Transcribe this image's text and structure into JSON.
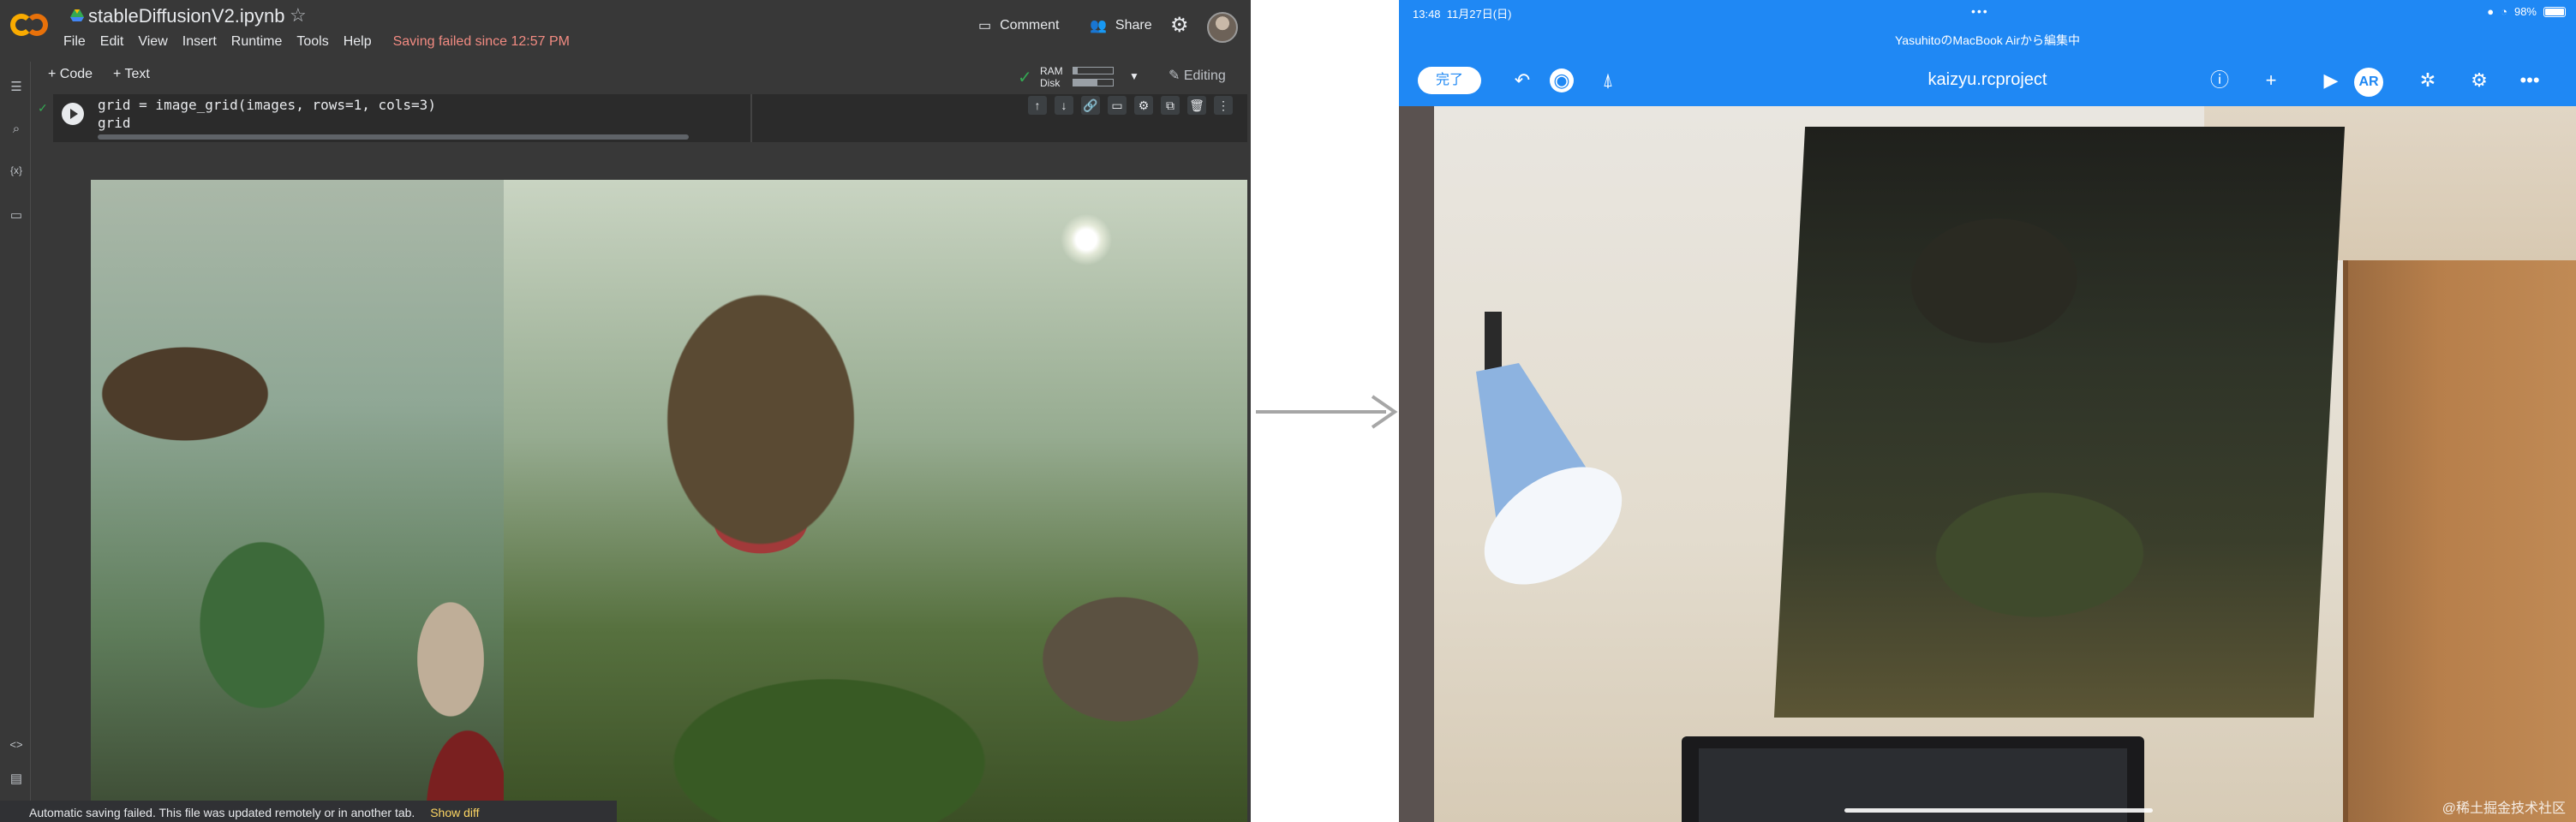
{
  "colab": {
    "notebook_title": "stableDiffusionV2.ipynb",
    "menu": [
      "File",
      "Edit",
      "View",
      "Insert",
      "Runtime",
      "Tools",
      "Help"
    ],
    "save_status": "Saving failed since 12:57 PM",
    "comment_label": "Comment",
    "share_label": "Share",
    "toolbar": {
      "add_code": "+ Code",
      "add_text": "+ Text",
      "ram_label": "RAM",
      "disk_label": "Disk",
      "editing_label": "Editing"
    },
    "cell": {
      "code_line1": "grid = image_grid(images, rows=1, cols=3)",
      "code_line2": "grid"
    },
    "toast": {
      "message": "Automatic saving failed. This file was updated remotely or in another tab.",
      "link": "Show diff"
    }
  },
  "ipad": {
    "status_time": "13:48",
    "status_date": "11月27日(日)",
    "battery": "98%",
    "editing_from": "YasuhitoのMacBook Airから編集中",
    "done_label": "完了",
    "project_title": "kaizyu.rcproject",
    "ar_label": "AR",
    "watermark": "@稀土掘金技术社区"
  },
  "colors": {
    "colab_bg": "#383838",
    "warning": "#f28b82",
    "ipad_blue": "#1f88f4"
  }
}
